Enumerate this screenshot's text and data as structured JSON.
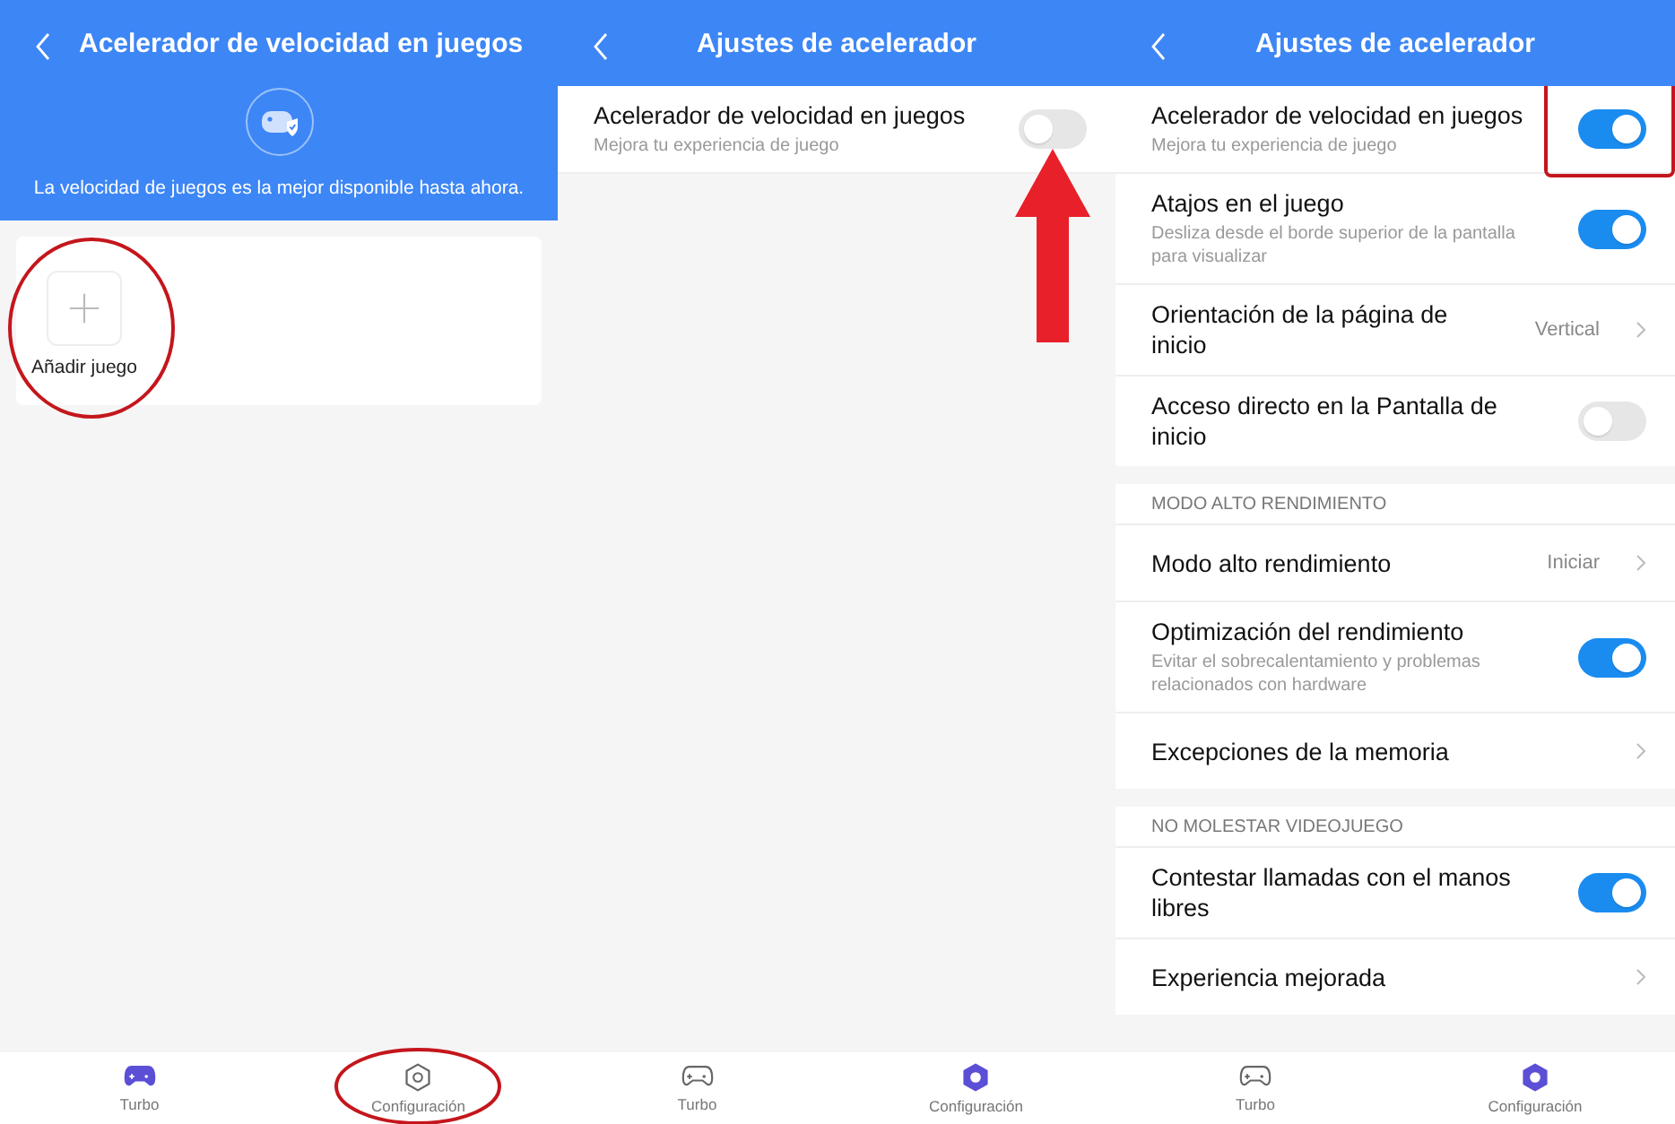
{
  "screens": [
    {
      "title": "Acelerador de velocidad en juegos",
      "banner": {
        "text": "La velocidad de juegos es la mejor disponible hasta ahora."
      },
      "games": [
        {
          "label": "Añadir juego",
          "highlight": {
            "kind": "circle"
          }
        }
      ],
      "nav": [
        {
          "label": "Turbo",
          "selected": true
        },
        {
          "label": "Configuración",
          "selected": false,
          "highlight": {
            "kind": "circle"
          }
        }
      ]
    },
    {
      "title": "Ajustes de acelerador",
      "groups": [
        {
          "rows": [
            {
              "kind": "toggle",
              "title": "Acelerador de velocidad en juegos",
              "subtitle": "Mejora tu experiencia de juego",
              "on": false,
              "highlight": {
                "kind": "arrow"
              }
            }
          ]
        }
      ],
      "nav": [
        {
          "label": "Turbo",
          "selected": false
        },
        {
          "label": "Configuración",
          "selected": true
        }
      ]
    },
    {
      "title": "Ajustes de acelerador",
      "groups": [
        {
          "rows": [
            {
              "kind": "toggle",
              "title": "Acelerador de velocidad en juegos",
              "subtitle": "Mejora tu experiencia de juego",
              "on": true,
              "highlight": {
                "kind": "box"
              }
            },
            {
              "kind": "toggle",
              "title": "Atajos en el juego",
              "subtitle": "Desliza desde el borde superior de la pantalla para visualizar",
              "on": true
            },
            {
              "kind": "link",
              "title": "Orientación de la página de inicio",
              "value": "Vertical"
            },
            {
              "kind": "toggle",
              "title": "Acceso directo en la Pantalla de inicio",
              "on": false
            }
          ]
        },
        {
          "header": "MODO ALTO RENDIMIENTO",
          "rows": [
            {
              "kind": "link",
              "title": "Modo alto rendimiento",
              "value": "Iniciar"
            },
            {
              "kind": "toggle",
              "title": "Optimización del rendimiento",
              "subtitle": "Evitar el sobrecalentamiento y problemas relacionados con hardware",
              "on": true
            },
            {
              "kind": "link",
              "title": "Excepciones de la memoria"
            }
          ]
        },
        {
          "header": "NO MOLESTAR VIDEOJUEGO",
          "rows": [
            {
              "kind": "toggle",
              "title": "Contestar llamadas con el manos libres",
              "on": true
            },
            {
              "kind": "link",
              "title": "Experiencia mejorada"
            }
          ]
        }
      ],
      "nav": [
        {
          "label": "Turbo",
          "selected": false
        },
        {
          "label": "Configuración",
          "selected": true
        }
      ]
    }
  ]
}
